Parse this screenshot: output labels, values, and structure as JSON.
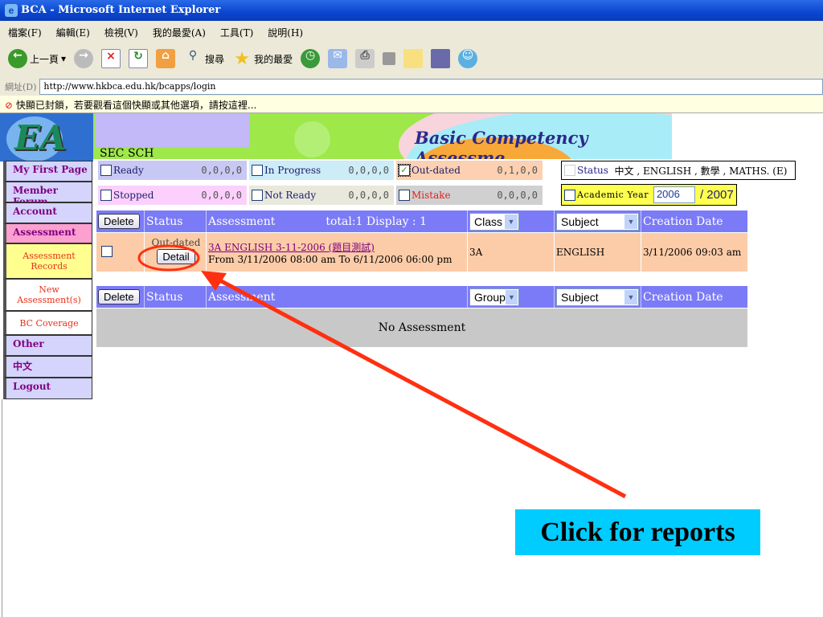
{
  "window": {
    "title": "BCA - Microsoft Internet Explorer"
  },
  "menu": [
    "檔案(F)",
    "編輯(E)",
    "檢視(V)",
    "我的最愛(A)",
    "工具(T)",
    "說明(H)"
  ],
  "toolbar": {
    "back": "上一頁",
    "search": "搜尋",
    "favorites": "我的最愛"
  },
  "address": {
    "label": "網址(D)",
    "url": "http://www.hkbca.edu.hk/bcapps/login"
  },
  "infobar": "快顯已封鎖，若要觀看這個快顯或其他選項，請按這裡...",
  "banner": {
    "title": "Basic Competency Assessme",
    "school": "SEC SCH",
    "logo": "EA"
  },
  "sidebar": [
    {
      "label": "My First Page"
    },
    {
      "label": "Member Forum"
    },
    {
      "label": "Account"
    },
    {
      "label": "Assessment"
    },
    {
      "label": "Assessment Records"
    },
    {
      "label": "New Assessment(s)"
    },
    {
      "label": "BC Coverage"
    },
    {
      "label": "Other"
    },
    {
      "label": "中文"
    },
    {
      "label": "Logout"
    }
  ],
  "filters": [
    {
      "label": "Ready",
      "value": "0,0,0,0",
      "checked": false
    },
    {
      "label": "In Progress",
      "value": "0,0,0,0",
      "checked": false
    },
    {
      "label": "Out-dated",
      "value": "0,1,0,0",
      "checked": true
    },
    {
      "label": "Stopped",
      "value": "0,0,0,0",
      "checked": false
    },
    {
      "label": "Not Ready",
      "value": "0,0,0,0",
      "checked": false
    },
    {
      "label": "Mistake",
      "value": "0,0,0,0",
      "checked": false
    }
  ],
  "status_filter": {
    "label": "Status",
    "subjects": "中文 , ENGLISH , 數學 , MATHS. (E)"
  },
  "academic_year": {
    "label": "Academic Year",
    "from": "2006",
    "to": "/ 2007"
  },
  "table1": {
    "delete": "Delete",
    "status": "Status",
    "assessment": "Assessment",
    "total": "total:1 Display : 1",
    "class": "Class",
    "subject": "Subject",
    "creation": "Creation Date",
    "rows": [
      {
        "status": "Out-dated",
        "detail": "Detail",
        "title": "3A ENGLISH 3-11-2006 (題目測試)",
        "period": "From 3/11/2006 08:00 am To 6/11/2006 06:00 pm",
        "class": "3A",
        "subject": "ENGLISH",
        "created": "3/11/2006 09:03 am"
      }
    ]
  },
  "table2": {
    "delete": "Delete",
    "status": "Status",
    "assessment": "Assessment",
    "group": "Group",
    "subject": "Subject",
    "creation": "Creation Date",
    "empty": "No Assessment"
  },
  "callout": "Click for reports",
  "colors": {
    "header": "#7b7bf7",
    "row": "#fccca8",
    "callout": "#00ccff",
    "arrow": "#ff3010"
  }
}
